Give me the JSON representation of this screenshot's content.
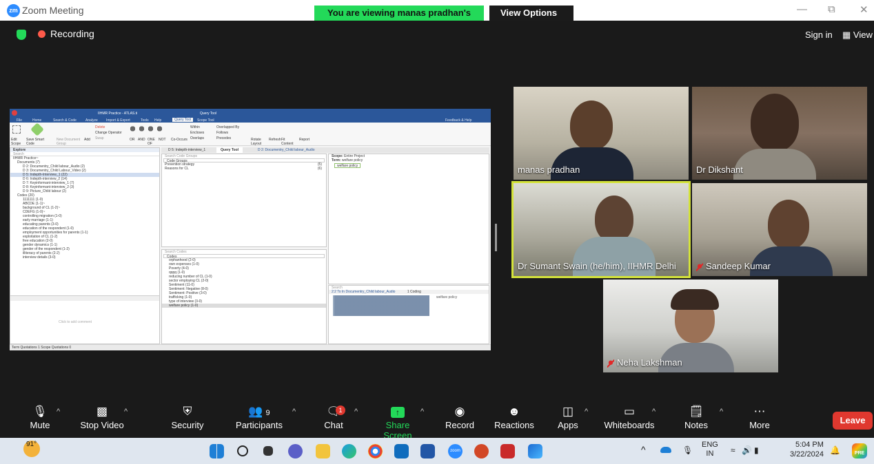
{
  "window": {
    "title": "Zoom Meeting",
    "logo": "zm",
    "minimize": "—",
    "restore": "⧉",
    "close": "✕"
  },
  "banner": {
    "text": "You are viewing manas pradhan's screen",
    "view_options": "View Options",
    "chevron": "⌄"
  },
  "recording": {
    "label": "Recording"
  },
  "top_right": {
    "sign_in": "Sign in",
    "view": "View"
  },
  "shared_screen": {
    "app_title": "IIHMR Practice - ATLAS.ti",
    "context_tab": "Query Tool",
    "menu": [
      "File",
      "Home",
      "Search & Code",
      "Analyze",
      "Import & Export",
      "Tools",
      "Help",
      "Query Tool",
      "Scope Tool"
    ],
    "feedback": "Feedback & Help",
    "ribbon": {
      "edit_scope": "Edit Scope",
      "save_smart_code": "Save Smart Code",
      "new_doc_group": "New Document Group",
      "add": "Add",
      "delete": "Delete",
      "change_operator": "Change Operator",
      "swap": "Swap",
      "ops": [
        "OR",
        "AND",
        "ONE OF",
        "NOT"
      ],
      "co_occurs": "Co-Occurs",
      "within": "Within",
      "encloses": "Encloses",
      "overlaps": "Overlaps",
      "overlapped_by": "Overlapped By",
      "follows": "Follows",
      "precedes": "Precedes",
      "rotate_layout": "Rotate Layout",
      "refresh": "Refresh",
      "fit_content": "Fit Content",
      "report": "Report"
    },
    "explore": {
      "title": "Explore",
      "search": "Search",
      "tree": [
        "IIHMR Practice~",
        "Documents (7)",
        "D 2: Documentry_Child labour_Audio (2)",
        "D 3: Documentry_Child Labour_Video (2)",
        "D 5: Indepth-Interview_1 (22)",
        "D 6: Indepth-interview_2 (14)",
        "D 7: Keyinformant-interview_1 (7)",
        "D 8: Keyinformant-interview_2 (3)",
        "D 9: Picture_Child labour (2)",
        "Codes (20)",
        "1111111 (1-0)",
        "ABCDE (1-1)~",
        "background of CL (1-2)~",
        "CDEFG (1-0)~",
        "controlling migration (1-0)",
        "early marriage (1-1)",
        "educating parents (3-0)",
        "education of the respondent (1-0)",
        "employment opportunities for parents (1-1)",
        "exploitation of CL (1-2)",
        "free education (2-0)",
        "gender dynamics (1-1)",
        "gender of the respondent (1-2)",
        "illiteracy of parents (2-2)",
        "interview details (3-0)"
      ],
      "comment": "Click to add comment"
    },
    "doc_tabs": [
      "D 5: Indepth-interview_1",
      "Query Tool",
      "D 2: Documentry_Child labour_Audio"
    ],
    "code_groups": {
      "search": "Search Code Groups",
      "header": "Code Groups",
      "items": [
        {
          "name": "Prevention strategy",
          "count": "(5)"
        },
        {
          "name": "Reasons for CL",
          "count": "(6)"
        }
      ]
    },
    "codes": {
      "search": "Search Codes",
      "header": "Codes",
      "items": [
        "orphanhood (2-0)",
        "own expenses (1-0)",
        "Poverty (4-0)",
        "qqqq (1-0)",
        "reducing number of CL (1-0)",
        "sector employing CL (2-0)",
        "Sentiment (11-0)",
        "Sentiment: Negative (8-0)",
        "Sentiment: Positive (3-0)",
        "trafficking (1-0)",
        "type of interview (3-0)",
        "welfare policy (1-0)"
      ]
    },
    "scope": {
      "label": "Scope:",
      "value": "Entire Project",
      "term_label": "Term:",
      "term_value": "welfare policy",
      "chip": "welfare policy"
    },
    "results": {
      "search": "Search",
      "doc": "2:2 To In Documentry_Child labour_Audio",
      "coding": "1 Coding",
      "code": "welfare policy"
    },
    "status": "Term Quotations 1  Scope Quotations 0"
  },
  "participants": [
    {
      "name": "manas pradhan",
      "muted": false
    },
    {
      "name": "Dr Dikshant",
      "muted": false
    },
    {
      "name": "Dr Sumant Swain (he/him), IIHMR Delhi",
      "muted": false,
      "active": true
    },
    {
      "name": "Sandeep Kumar",
      "muted": true
    },
    {
      "name": "Neha Lakshman",
      "muted": true
    }
  ],
  "toolbar": {
    "mute": "Mute",
    "stop_video": "Stop Video",
    "security": "Security",
    "participants": "Participants",
    "participant_count": "9",
    "chat": "Chat",
    "chat_badge": "1",
    "share_screen": "Share Screen",
    "record": "Record",
    "reactions": "Reactions",
    "apps": "Apps",
    "whiteboards": "Whiteboards",
    "notes": "Notes",
    "more": "More",
    "leave": "Leave"
  },
  "taskbar": {
    "weather": "91°",
    "lang": "ENG",
    "region": "IN",
    "time": "5:04 PM",
    "date": "3/22/2024",
    "badge": "PRE"
  },
  "colors": {
    "banner": "#23d959",
    "leave": "#e0382f",
    "active_border": "#d4e33a",
    "atlas_blue": "#2b579a"
  }
}
